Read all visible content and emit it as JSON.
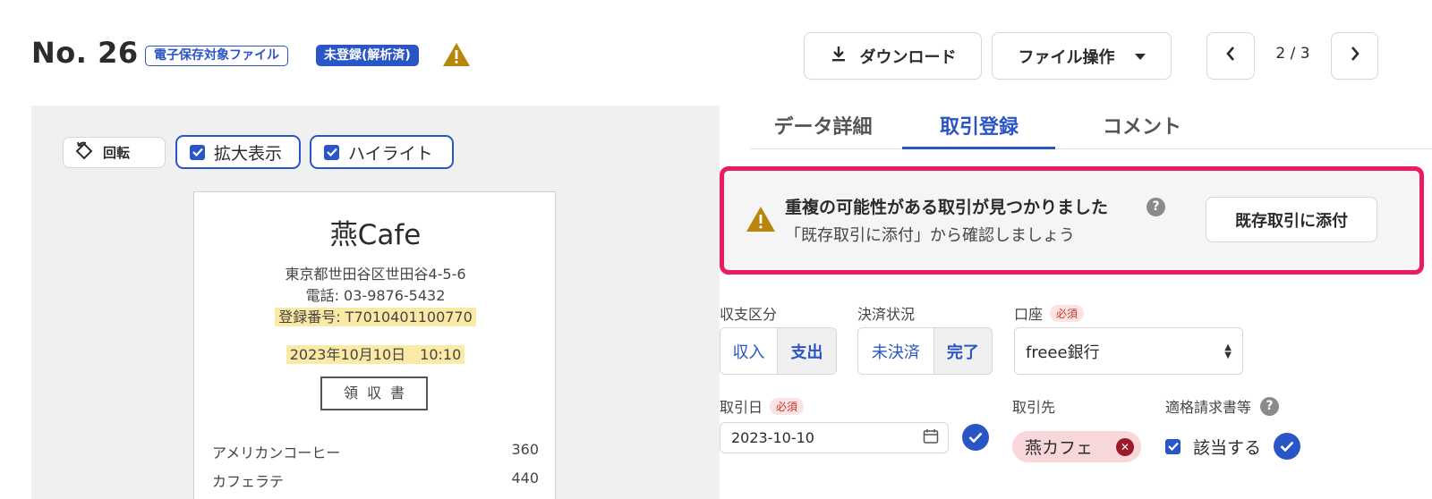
{
  "header": {
    "doc_number": "No. 26",
    "badge_file_type": "電子保存対象ファイル",
    "badge_status": "未登録(解析済)",
    "warning_icon": "warning-triangle-icon",
    "download_label": "ダウンロード",
    "file_ops_label": "ファイル操作",
    "pager": "2 / 3"
  },
  "viewer": {
    "rotate_label": "回転",
    "zoom_label": "拡大表示",
    "highlight_label": "ハイライト",
    "receipt": {
      "shop": "燕Cafe",
      "address": "東京都世田谷区世田谷4-5-6",
      "phone": "電話: 03-9876-5432",
      "registration": "登録番号: T7010401100770",
      "datetime": "2023年10月10日　10:10",
      "stamp": "領収書",
      "items": [
        {
          "name": "アメリカンコーヒー",
          "price": "360"
        },
        {
          "name": "カフェラテ",
          "price": "440"
        }
      ]
    }
  },
  "tabs": [
    {
      "label": "データ詳細"
    },
    {
      "label": "取引登録"
    },
    {
      "label": "コメント"
    }
  ],
  "active_tab": "取引登録",
  "alert": {
    "title": "重複の可能性がある取引が見つかりました",
    "subtitle": "「既存取引に添付」から確認しましょう",
    "button_label": "既存取引に添付"
  },
  "form": {
    "kind_label": "収支区分",
    "kind_options": [
      "収入",
      "支出"
    ],
    "kind_selected": "支出",
    "settle_label": "決済状況",
    "settle_options": [
      "未決済",
      "完了"
    ],
    "settle_selected": "完了",
    "account_label": "口座",
    "required_badge": "必須",
    "account_value": "freee銀行",
    "date_label": "取引日",
    "date_value": "2023-10-10",
    "partner_label": "取引先",
    "partner_value": "燕カフェ",
    "qualified_label": "適格請求書等",
    "qualified_option": "該当する"
  },
  "colors": {
    "accent": "#2a55c6",
    "alert_border": "#ea1c5e",
    "warning": "#b8860b",
    "required_bg": "#fde3e3",
    "chip_bg": "#f8d7da"
  }
}
